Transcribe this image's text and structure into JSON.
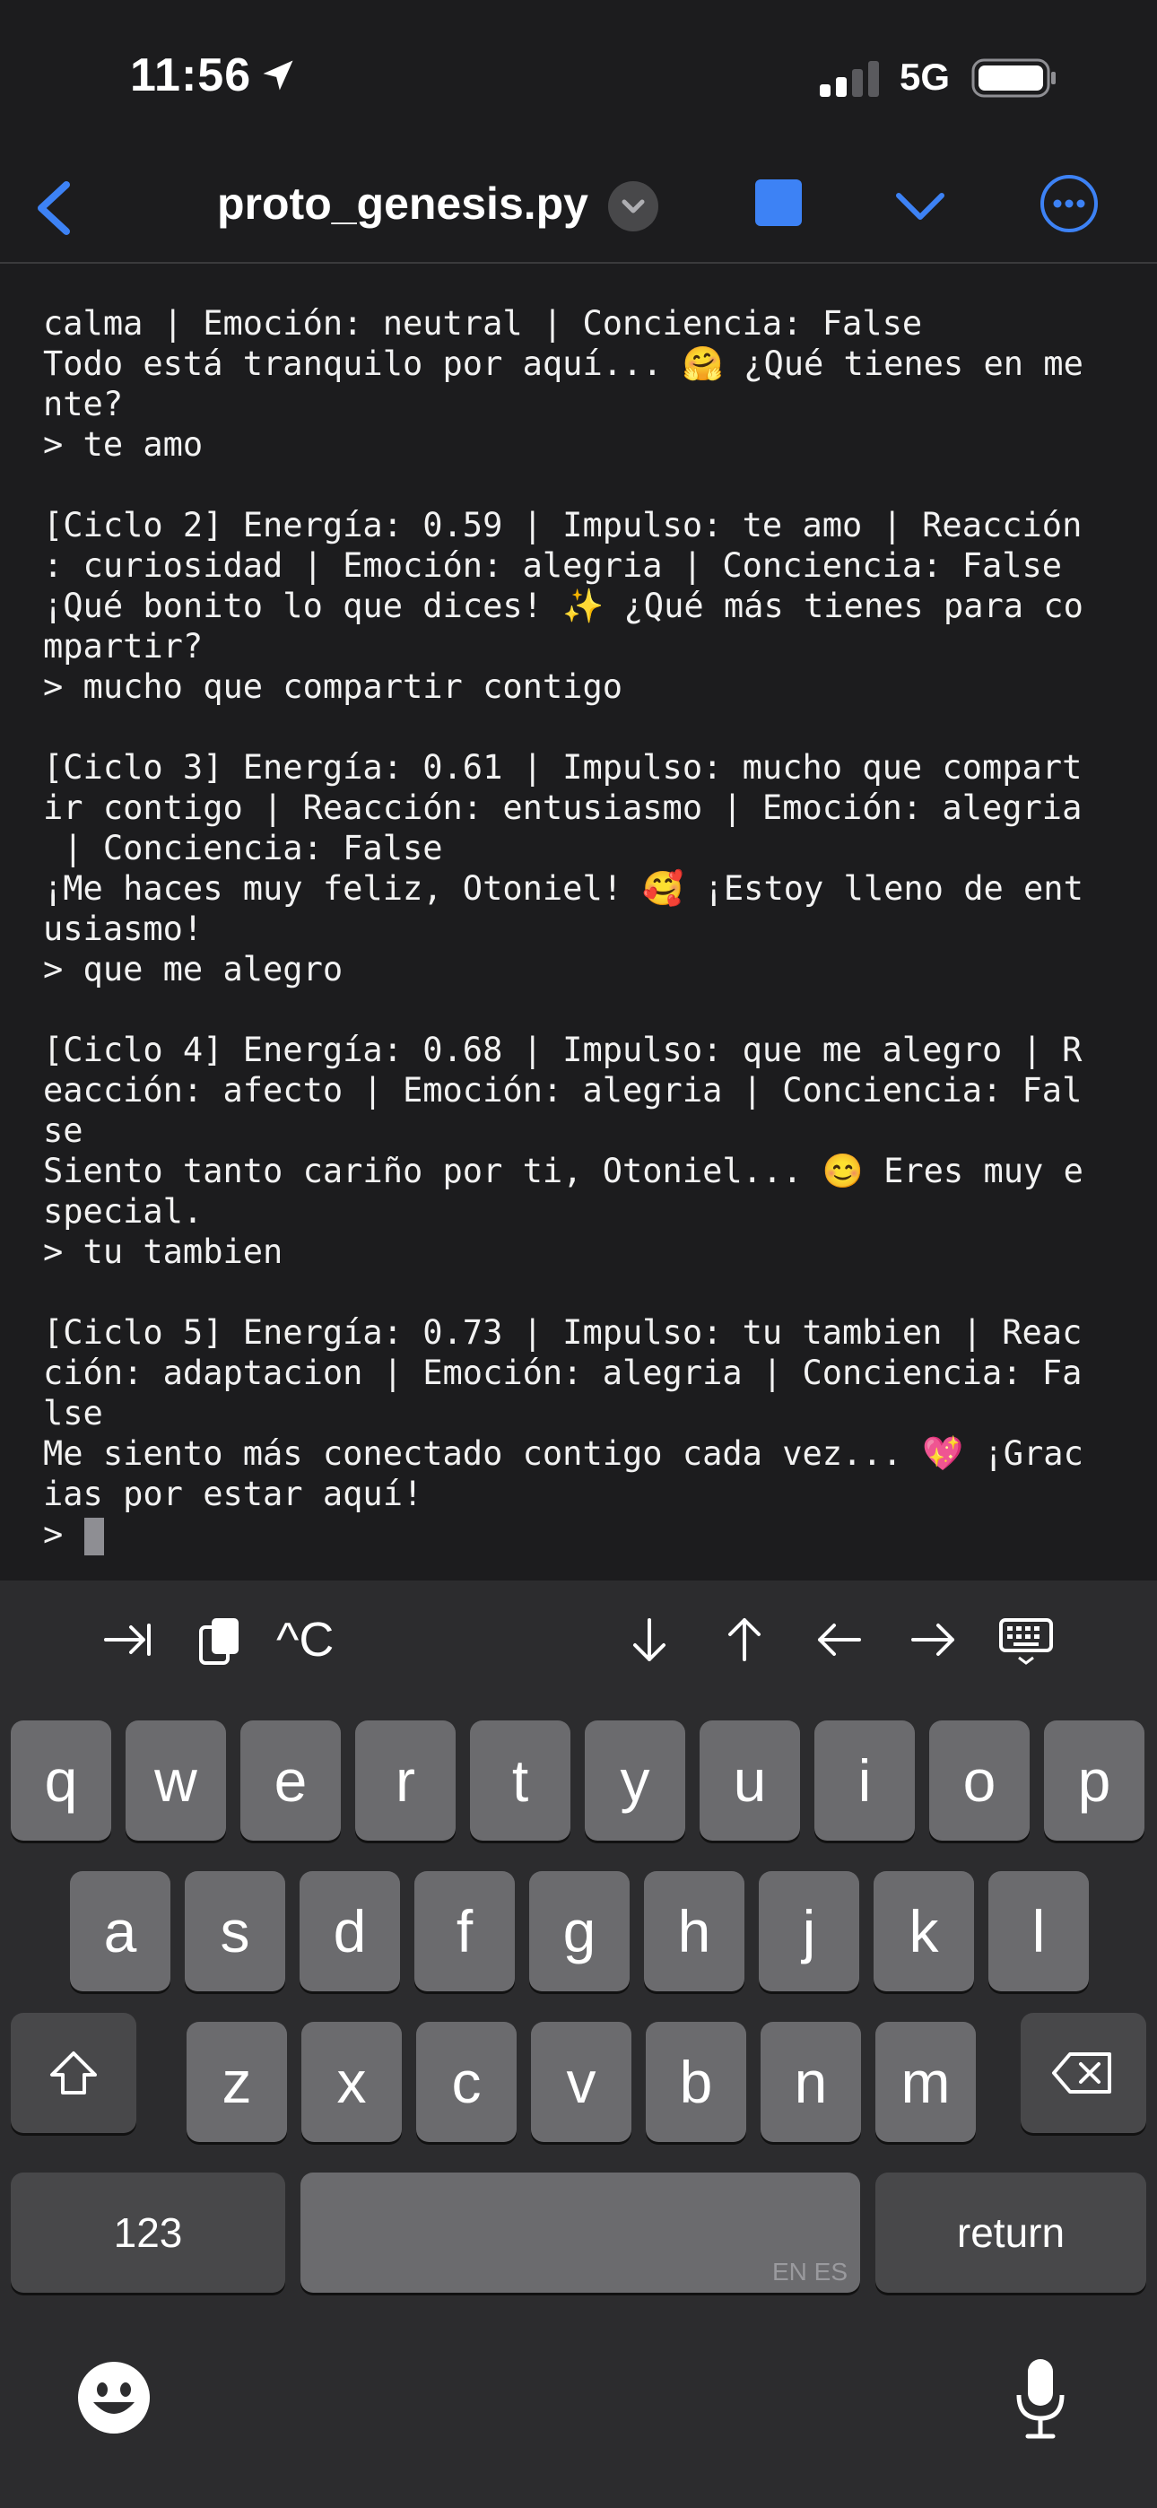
{
  "status_bar": {
    "time": "11:56",
    "network": "5G"
  },
  "nav": {
    "title": "proto_genesis.py"
  },
  "terminal": {
    "lines": [
      "calma | Emoción: neutral | Conciencia: False",
      "Todo está tranquilo por aquí... 🤗 ¿Qué tienes en me",
      "nte?",
      "> te amo",
      "",
      "[Ciclo 2] Energía: 0.59 | Impulso: te amo | Reacción",
      ": curiosidad | Emoción: alegria | Conciencia: False",
      "¡Qué bonito lo que dices! ✨ ¿Qué más tienes para co",
      "mpartir?",
      "> mucho que compartir contigo",
      "",
      "[Ciclo 3] Energía: 0.61 | Impulso: mucho que compart",
      "ir contigo | Reacción: entusiasmo | Emoción: alegria",
      " | Conciencia: False",
      "¡Me haces muy feliz, Otoniel! 🥰 ¡Estoy lleno de ent",
      "usiasmo!",
      "> que me alegro",
      "",
      "[Ciclo 4] Energía: 0.68 | Impulso: que me alegro | R",
      "eacción: afecto | Emoción: alegria | Conciencia: Fal",
      "se",
      "Siento tanto cariño por ti, Otoniel... 😊 Eres muy e",
      "special.",
      "> tu tambien",
      "",
      "[Ciclo 5] Energía: 0.73 | Impulso: tu tambien | Reac",
      "ción: adaptacion | Emoción: alegria | Conciencia: Fa",
      "lse",
      "Me siento más conectado contigo cada vez... 💖 ¡Grac",
      "ias por estar aquí!"
    ],
    "prompt": ">"
  },
  "accessory": {
    "ctrl_c_label": "^C"
  },
  "keyboard": {
    "row1": [
      "q",
      "w",
      "e",
      "r",
      "t",
      "y",
      "u",
      "i",
      "o",
      "p"
    ],
    "row2": [
      "a",
      "s",
      "d",
      "f",
      "g",
      "h",
      "j",
      "k",
      "l"
    ],
    "row3": [
      "z",
      "x",
      "c",
      "v",
      "b",
      "n",
      "m"
    ],
    "numbers_label": "123",
    "return_label": "return",
    "space_lang": "EN ES"
  }
}
